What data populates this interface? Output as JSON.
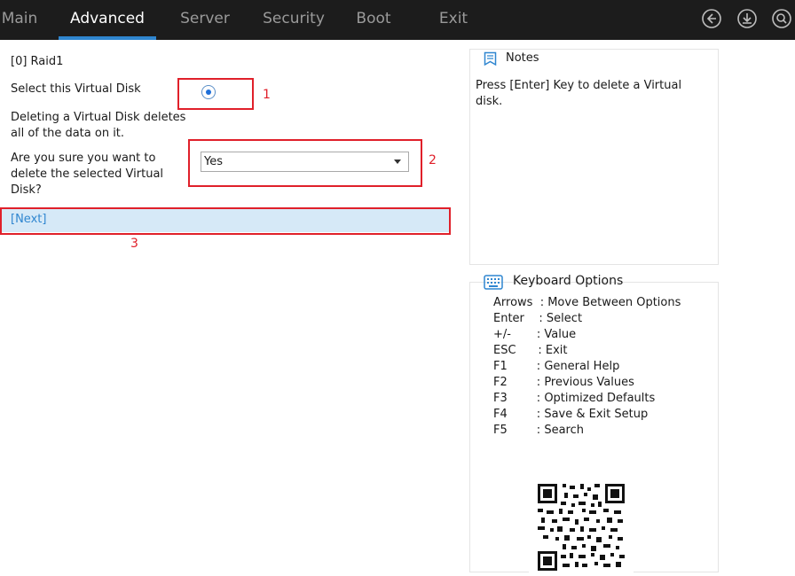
{
  "menu": {
    "tabs": [
      {
        "label": "Main"
      },
      {
        "label": "Advanced"
      },
      {
        "label": "Server"
      },
      {
        "label": "Security"
      },
      {
        "label": "Boot"
      },
      {
        "label": "Exit"
      }
    ],
    "active_tab": "Advanced",
    "icons": [
      "back-icon",
      "download-icon",
      "search-icon"
    ]
  },
  "form": {
    "disk_label": "[0] Raid1",
    "select_disk_label": "Select this Virtual Disk",
    "warning_text_line1": "Deleting a Virtual Disk deletes",
    "warning_text_line2": "all of the data on it.",
    "confirm_label_line1": "Are you sure you want to",
    "confirm_label_line2": "delete the selected Virtual",
    "confirm_label_line3": "Disk?",
    "confirm_value": "Yes",
    "next_label": "[Next]",
    "radio_selected": true
  },
  "annotations": {
    "marker1": "1",
    "marker2": "2",
    "marker3": "3",
    "color": "#e0202a"
  },
  "notes": {
    "title": "Notes",
    "text_line1": "Press [Enter] Key to delete a Virtual",
    "text_line2": "disk."
  },
  "keyboard": {
    "title": "Keyboard Options",
    "rows": [
      "Arrows  : Move Between Options",
      "Enter    : Select",
      "+/-       : Value",
      "ESC      : Exit",
      "F1        : General Help",
      "F2        : Previous Values",
      "F3        : Optimized Defaults",
      "F4        : Save & Exit Setup",
      "F5        : Search"
    ]
  },
  "colors": {
    "topbar": "#1c1c1c",
    "accent": "#2f86d0",
    "highlight_row": "#d6e9f7"
  }
}
